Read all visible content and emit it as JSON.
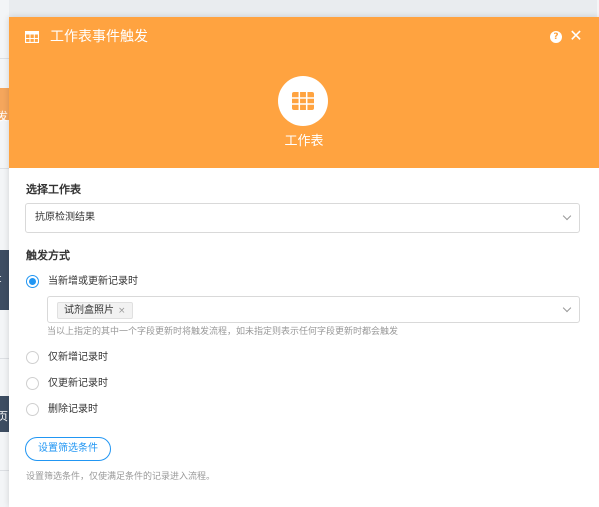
{
  "background": {
    "side_fragments": [
      "发",
      "t",
      "页"
    ]
  },
  "panel": {
    "title": "工作表事件触发",
    "title_icon": "table-grid-icon",
    "help_icon": "question-icon",
    "help_glyph": "?",
    "close_icon": "close-icon",
    "close_glyph": "✕",
    "center_icon": "table-grid-icon",
    "center_label": "工作表",
    "accent_color": "#ffa340",
    "primary_color": "#2196f3"
  },
  "worksheet": {
    "label": "选择工作表",
    "selected": "抗原检测结果"
  },
  "trigger": {
    "label": "触发方式",
    "options": [
      {
        "label": "当新增或更新记录时",
        "checked": true
      },
      {
        "label": "仅新增记录时",
        "checked": false
      },
      {
        "label": "仅更新记录时",
        "checked": false
      },
      {
        "label": "删除记录时",
        "checked": false
      }
    ],
    "field_tag": "试剂盒照片",
    "field_tag_remove": "×",
    "field_hint": "当以上指定的其中一个字段更新时将触发流程，如未指定则表示任何字段更新时都会触发"
  },
  "filter": {
    "button_label": "设置筛选条件",
    "hint": "设置筛选条件，仅使满足条件的记录进入流程。"
  }
}
